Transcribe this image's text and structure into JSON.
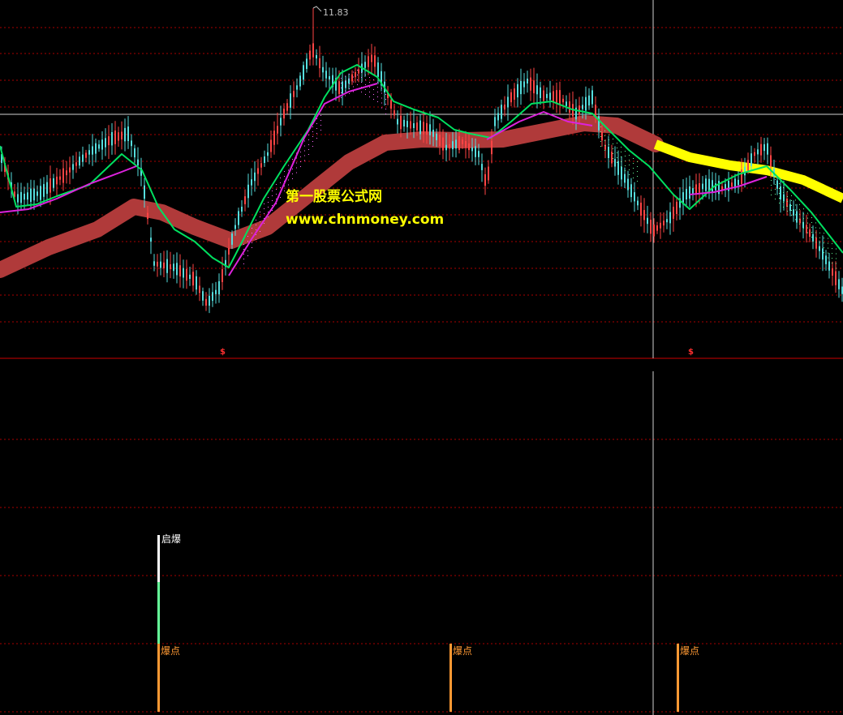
{
  "chart_data": [
    {
      "type": "candlestick",
      "panel": "main",
      "title": "",
      "peak_label": "11.83",
      "indicators": [
        {
          "color": "#b03a3a",
          "style": "thick band"
        },
        {
          "color": "#ffff00",
          "style": "thick band"
        },
        {
          "color": "#00e060",
          "style": "line"
        },
        {
          "color": "#dd22dd",
          "style": "line"
        }
      ],
      "signal_markers": [
        "$",
        "$"
      ],
      "grid": "dashed red horizontal lines",
      "crosshair": true
    },
    {
      "type": "bar",
      "panel": "signal",
      "labels": {
        "start": "启爆",
        "burst": "爆点"
      },
      "bursts": [
        {
          "label": "爆点"
        },
        {
          "label": "爆点"
        },
        {
          "label": "爆点"
        }
      ],
      "start_signal": {
        "label": "启爆"
      },
      "colors": {
        "burst": "#ff9933",
        "start_top": "#ffffff",
        "start_bottom": "#66ff99"
      }
    }
  ],
  "watermark": {
    "site_name": "第一股票公式网",
    "url": "www.chnmoney.com"
  },
  "colors": {
    "background": "#000000",
    "grid": "#aa0000",
    "up_candle": "#ff4444",
    "down_candle": "#55dddd",
    "watermark": "#ffff00"
  }
}
